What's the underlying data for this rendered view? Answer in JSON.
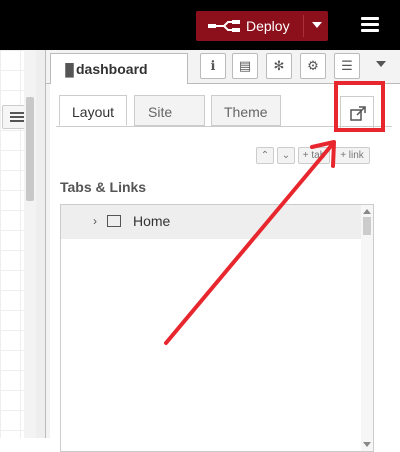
{
  "header": {
    "deploy_label": "Deploy"
  },
  "sidebar": {
    "tab_label": "dashboard",
    "subtabs": [
      "Layout",
      "Site",
      "Theme"
    ],
    "section_title": "Tabs & Links",
    "buttons": {
      "expand": "⌃",
      "collapse": "⌄",
      "tab": "+ tab",
      "link": "+ link"
    },
    "tree": [
      {
        "label": "Home"
      }
    ]
  },
  "colors": {
    "accent": "#8c101c",
    "annotation": "#e8262d",
    "topbar": "#000000"
  },
  "icons": {
    "menu": "hamburger-icon",
    "deploy": "deploy-flow-icon",
    "popout": "external-link-icon"
  }
}
